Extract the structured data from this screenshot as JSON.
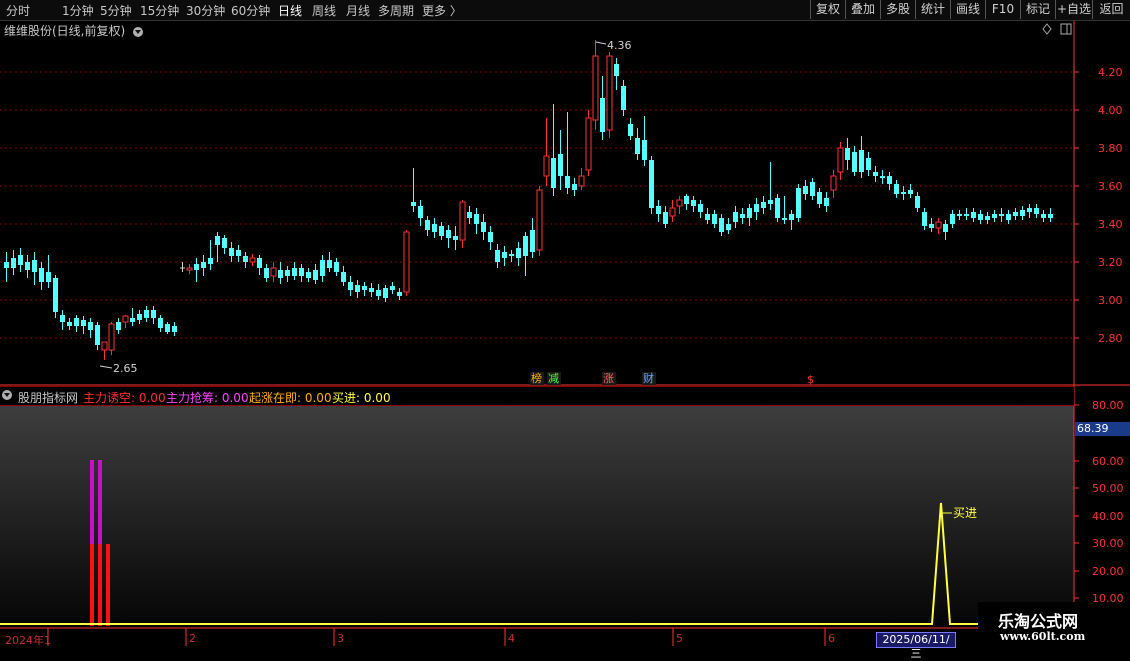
{
  "toolbar": {
    "periods": [
      "分时",
      "1分钟",
      "5分钟",
      "15分钟",
      "30分钟",
      "60分钟",
      "日线",
      "周线",
      "月线",
      "多周期",
      "更多 〉"
    ],
    "active_period": "日线",
    "buttons": [
      "复权",
      "叠加",
      "多股",
      "统计",
      "画线",
      "F10",
      "标记",
      "+自选",
      "返回"
    ]
  },
  "stock_title": "维维股份(日线,前复权)",
  "main_chart": {
    "y_labels": [
      "4.20",
      "4.00",
      "3.80",
      "3.60",
      "3.40",
      "3.20",
      "3.00",
      "2.80"
    ],
    "high_label": "4.36",
    "low_label": "2.65",
    "colors": {
      "up": "#ff3232",
      "down": "#54ffff",
      "grid": "#8b0000",
      "axis": "#ff3232"
    }
  },
  "event_markers": [
    {
      "text": "榜",
      "color": "#ffb000"
    },
    {
      "text": "减",
      "color": "#40ff40"
    },
    {
      "text": "涨",
      "color": "#ff6060"
    },
    {
      "text": "财",
      "color": "#6aa0ff"
    },
    {
      "text": "$",
      "color": "#ff3030"
    }
  ],
  "indicator": {
    "name": "股朋指标网",
    "items": [
      {
        "label": "主力诱空: 0.00",
        "color": "#ff3030"
      },
      {
        "label": "主力抢筹: 0.00",
        "color": "#ff40ff"
      },
      {
        "label": "起涨在即: 0.00",
        "color": "#ffb000"
      },
      {
        "label": "买进: 0.00",
        "color": "#ffff40"
      }
    ],
    "y_labels": [
      "80.00",
      "60.00",
      "50.00",
      "40.00",
      "30.00",
      "20.00",
      "10.00"
    ],
    "current_value": "68.39",
    "buy_label": "买进"
  },
  "time_axis": {
    "labels": [
      "2024年1",
      "2",
      "3",
      "4",
      "5",
      "6"
    ],
    "current_date": "2025/06/11/三"
  },
  "watermark": {
    "line1": "乐淘公式网",
    "line2": "www.60lt.com"
  }
}
